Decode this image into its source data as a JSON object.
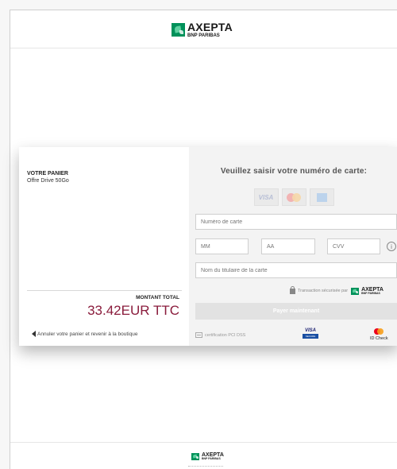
{
  "brand": {
    "name": "AXEPTA",
    "subname": "BNP PARIBAS",
    "color": "#00915a"
  },
  "cart": {
    "title": "VOTRE PANIER",
    "item": "Offre Drive 50Go",
    "total_label": "MONTANT TOTAL",
    "total_amount": "33.42EUR TTC",
    "cancel_link": "Annuler votre panier et revenir à la boutique"
  },
  "payment": {
    "title": "Veuillez saisir votre numéro de carte:",
    "card_logos": [
      "visa-logo",
      "mastercard-logo",
      "amex-logo"
    ],
    "visa_label": "VISA",
    "fields": {
      "card_number": {
        "placeholder": "Numéro de carte",
        "value": ""
      },
      "month": {
        "placeholder": "MM",
        "value": ""
      },
      "year": {
        "placeholder": "AA",
        "value": ""
      },
      "cvv": {
        "placeholder": "CVV",
        "value": ""
      },
      "holder": {
        "placeholder": "Nom du titulaire de la carte",
        "value": ""
      }
    },
    "info_glyph": "i",
    "secure_text": "Transaction sécurisée par",
    "pay_button": "Payer maintenant",
    "pci_text": "certification PCI DSS",
    "visa_secure": {
      "top": "VISA",
      "bottom": "SECURE"
    },
    "id_check": "ID Check",
    "accent_color": "#8a1c3c"
  }
}
